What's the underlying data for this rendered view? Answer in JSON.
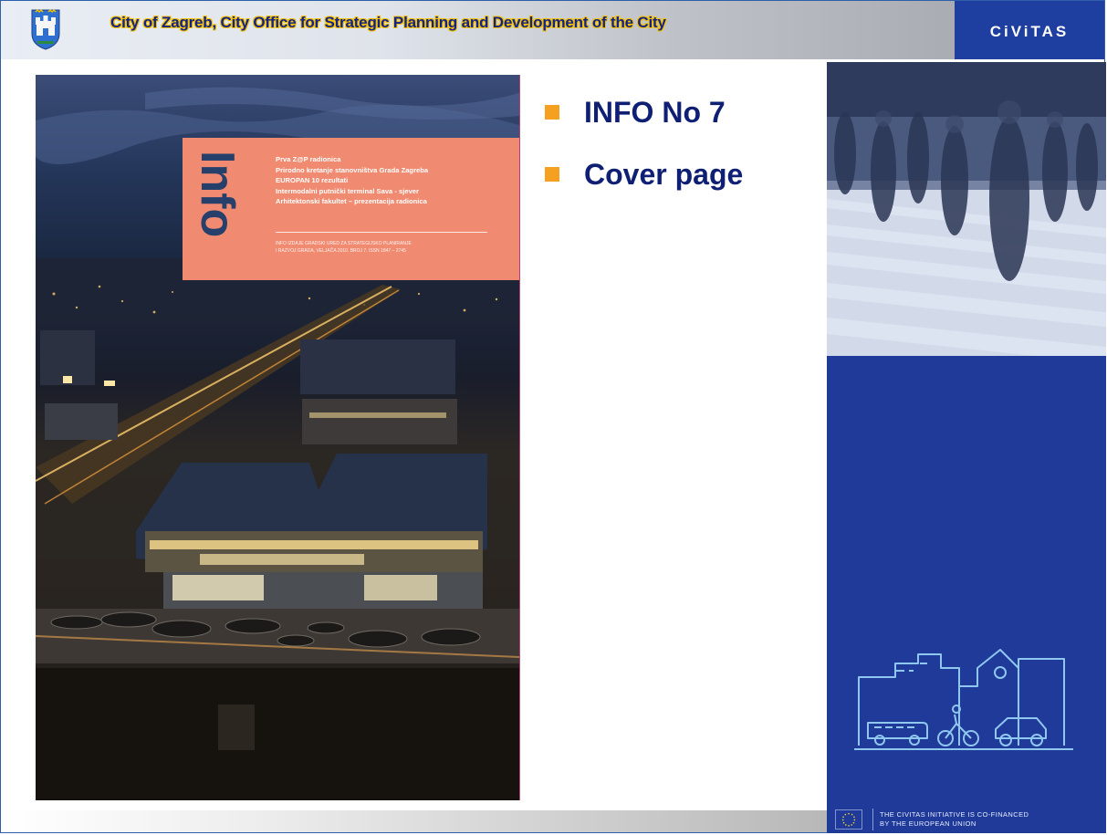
{
  "header": {
    "title": "City of Zagreb, City Office for Strategic Planning and Development of the City",
    "brand": "CiViTAS"
  },
  "cover": {
    "info_word": "Info",
    "lines": [
      "Prva Z@P radionica",
      "Prirodno kretanje stanovništva Grada Zagreba",
      "EUROPAN 10 rezultati",
      "Intermodalni putnički terminal Sava - sjever",
      "Arhitektonski fakultet – prezentacija radionica"
    ],
    "footer_lines": [
      "INFO IZDAJE GRADSKI URED ZA STRATEGIJSKO PLANIRANJE",
      "I RAZVOJ GRADA, VELJAČA 2010. BROJ 7. ISSN 1847 – 2745"
    ]
  },
  "bullets": [
    {
      "label": "INFO No 7"
    },
    {
      "label": "Cover page"
    }
  ],
  "footer": {
    "eu_line1": "THE CIVITAS INITIATIVE IS CO-FINANCED",
    "eu_line2": "BY THE EUROPEAN UNION"
  },
  "colors": {
    "brand_blue": "#1f3a98",
    "title_blue": "#0f1f73",
    "bullet_orange": "#f5a021",
    "cover_panel": "#f08a70"
  }
}
